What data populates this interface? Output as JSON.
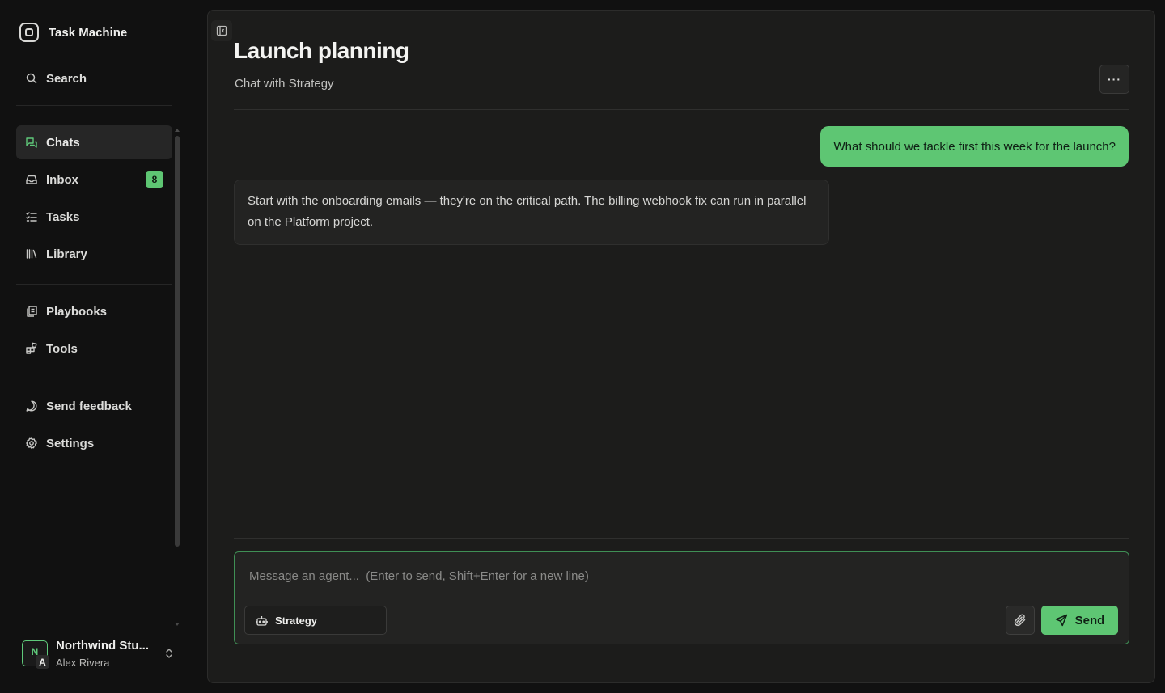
{
  "app": {
    "name": "Task Machine"
  },
  "sidebar": {
    "search_label": "Search",
    "nav": [
      {
        "label": "Chats",
        "icon": "chat-bubbles-icon",
        "active": true
      },
      {
        "label": "Inbox",
        "icon": "inbox-icon",
        "badge": "8"
      },
      {
        "label": "Tasks",
        "icon": "tasks-list-icon"
      },
      {
        "label": "Library",
        "icon": "library-icon"
      }
    ],
    "secondary": [
      {
        "label": "Playbooks",
        "icon": "playbooks-icon"
      },
      {
        "label": "Tools",
        "icon": "tools-blocks-icon"
      }
    ],
    "footer_links": [
      {
        "label": "Send feedback",
        "icon": "feedback-bubble-icon"
      },
      {
        "label": "Settings",
        "icon": "gear-icon"
      }
    ],
    "workspace": {
      "name": "Northwind Stu...",
      "initial": "N",
      "user_name": "Alex Rivera",
      "user_initial": "A"
    }
  },
  "conversation": {
    "title": "Launch planning",
    "subtitle": "Chat with Strategy",
    "more_label": "···",
    "messages": [
      {
        "role": "user",
        "text": "What should we tackle first this week for the launch?"
      },
      {
        "role": "agent",
        "text": "Start with the onboarding emails — they're on the critical path. The billing webhook fix can run in parallel on the Platform project."
      }
    ]
  },
  "composer": {
    "placeholder": "Message an agent...  (Enter to send, Shift+Enter for a new line)",
    "agent": "Strategy",
    "send_label": "Send"
  },
  "colors": {
    "accent": "#5ec673",
    "background": "#111111",
    "panel": "#1c1c1b"
  }
}
